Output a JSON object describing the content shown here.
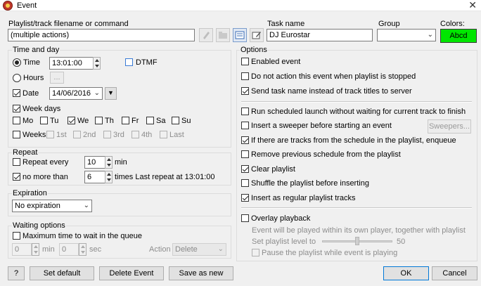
{
  "window": {
    "title": "Event",
    "close_glyph": "✕"
  },
  "top": {
    "filename_label": "Playlist/track filename or command",
    "filename_value": "(multiple actions)",
    "task_label": "Task name",
    "task_value": "DJ Eurostar",
    "group_label": "Group",
    "group_value": "",
    "colors_label": "Colors:",
    "color_swatch_text": "Abcd",
    "color_swatch_bg": "#00e600"
  },
  "time_day": {
    "title": "Time and day",
    "time_label": "Time",
    "time_value": "13:01:00",
    "dtmf_label": "DTMF",
    "hours_label": "Hours",
    "hours_button": "...",
    "date_label": "Date",
    "date_value": "14/06/2016",
    "week_days_label": "Week days",
    "days": [
      "Mo",
      "Tu",
      "We",
      "Th",
      "Fr",
      "Sa",
      "Su"
    ],
    "days_checked": [
      false,
      false,
      true,
      false,
      false,
      false,
      false
    ],
    "weeks_label": "Weeks",
    "weeks": [
      "1st",
      "2nd",
      "3rd",
      "4th",
      "Last"
    ]
  },
  "repeat": {
    "title": "Repeat",
    "every_label": "Repeat every",
    "every_value": "10",
    "every_unit": "min",
    "nomore_label": "no more than",
    "nomore_value": "6",
    "nomore_suffix": "times Last repeat at 13:01:00"
  },
  "expiration": {
    "title": "Expiration",
    "value": "No expiration"
  },
  "waiting": {
    "title": "Waiting options",
    "max_label": "Maximum time to wait in the queue",
    "min_value": "0",
    "min_unit": "min",
    "sec_value": "0",
    "sec_unit": "sec",
    "action_label": "Action",
    "action_value": "Delete"
  },
  "options": {
    "title": "Options",
    "items": [
      {
        "label": "Enabled event",
        "checked": false
      },
      {
        "label": "Do not action this event when playlist is stopped",
        "checked": false
      },
      {
        "label": "Send task name instead of track titles to server",
        "checked": true
      },
      {
        "label": "Run scheduled launch without waiting for current track to finish",
        "checked": false
      },
      {
        "label": "Insert a sweeper before starting an event",
        "checked": false
      },
      {
        "label": "If there are tracks from the schedule in the playlist, enqueue",
        "checked": true
      },
      {
        "label": "Remove previous schedule from the playlist",
        "checked": false
      },
      {
        "label": "Clear playlist",
        "checked": true
      },
      {
        "label": "Shuffle the playlist before inserting",
        "checked": false
      },
      {
        "label": "Insert as regular playlist tracks",
        "checked": true
      }
    ],
    "sweepers_button": "Sweepers...",
    "overlay_label": "Overlay playback",
    "overlay_note": "Event will be played within its own player, together with playlist",
    "level_label": "Set playlist level to",
    "level_value": "50",
    "level_fraction": 0.5,
    "pause_label": "Pause the playlist while event is playing"
  },
  "buttons": {
    "help": "?",
    "set_default": "Set default",
    "delete_event": "Delete Event",
    "save_as_new": "Save as new",
    "ok": "OK",
    "cancel": "Cancel"
  },
  "icons": [
    "event-app-icon",
    "pencil-icon",
    "folder-icon",
    "playlist-icon",
    "edit-icon",
    "dropdown-arrow-icon",
    "calendar-button-icon"
  ]
}
